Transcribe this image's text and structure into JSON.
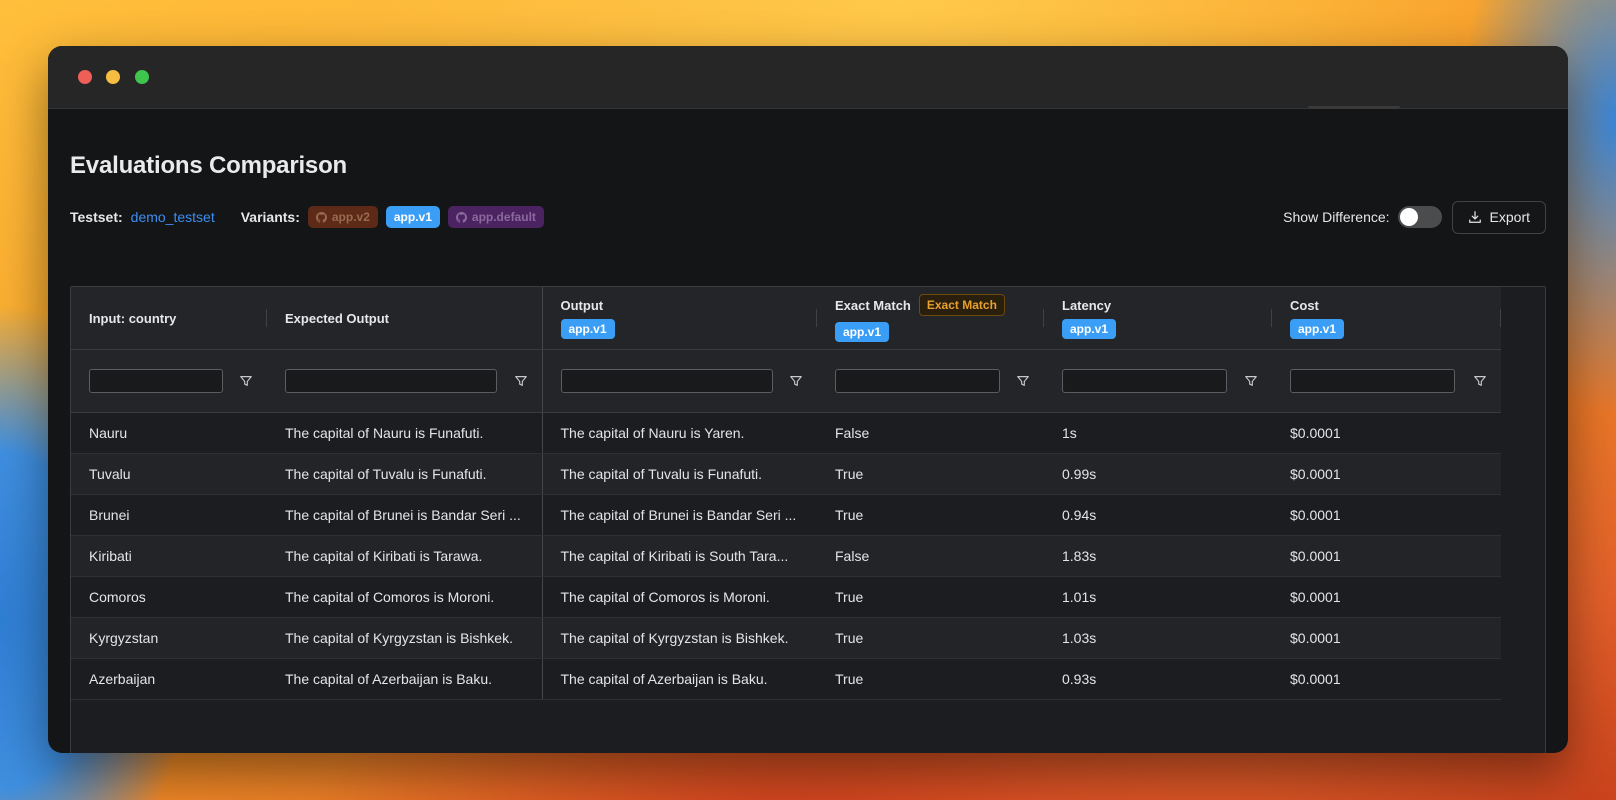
{
  "page": {
    "title": "Evaluations Comparison",
    "testset_label": "Testset:",
    "testset_value": "demo_testset",
    "variants_label": "Variants:",
    "variants": [
      "app.v2",
      "app.v1",
      "app.default"
    ],
    "show_difference_label": "Show Difference:",
    "show_difference_on": false,
    "export_label": "Export"
  },
  "colors": {
    "accent": "#3a9ef6",
    "link": "#3d8df2",
    "exact_match_badge": "#e7a12c",
    "variant_v2": "#5c2a17",
    "variant_default": "#4a2360"
  },
  "icons": [
    "github-icon",
    "filter-icon",
    "download-icon"
  ],
  "table": {
    "columns": {
      "input": "Input: country",
      "expected": "Expected Output",
      "output": "Output",
      "exact_match": "Exact Match",
      "exact_match_badge": "Exact Match",
      "latency": "Latency",
      "cost": "Cost",
      "variant_tag": "app.v1"
    },
    "rows": [
      {
        "input": "Nauru",
        "expected": "The capital of Nauru is Funafuti.",
        "output": "The capital of Nauru is Yaren.",
        "exact_match": "False",
        "latency": "1s",
        "cost": "$0.0001"
      },
      {
        "input": "Tuvalu",
        "expected": "The capital of Tuvalu is Funafuti.",
        "output": "The capital of Tuvalu is Funafuti.",
        "exact_match": "True",
        "latency": "0.99s",
        "cost": "$0.0001"
      },
      {
        "input": "Brunei",
        "expected": "The capital of Brunei is Bandar Seri ...",
        "output": "The capital of Brunei is Bandar Seri ...",
        "exact_match": "True",
        "latency": "0.94s",
        "cost": "$0.0001"
      },
      {
        "input": "Kiribati",
        "expected": "The capital of Kiribati is Tarawa.",
        "output": "The capital of Kiribati is South Tara...",
        "exact_match": "False",
        "latency": "1.83s",
        "cost": "$0.0001"
      },
      {
        "input": "Comoros",
        "expected": "The capital of Comoros is Moroni.",
        "output": "The capital of Comoros is Moroni.",
        "exact_match": "True",
        "latency": "1.01s",
        "cost": "$0.0001"
      },
      {
        "input": "Kyrgyzstan",
        "expected": "The capital of Kyrgyzstan is Bishkek.",
        "output": "The capital of Kyrgyzstan is Bishkek.",
        "exact_match": "True",
        "latency": "1.03s",
        "cost": "$0.0001"
      },
      {
        "input": "Azerbaijan",
        "expected": "The capital of Azerbaijan is Baku.",
        "output": "The capital of Azerbaijan is Baku.",
        "exact_match": "True",
        "latency": "0.93s",
        "cost": "$0.0001"
      }
    ]
  }
}
